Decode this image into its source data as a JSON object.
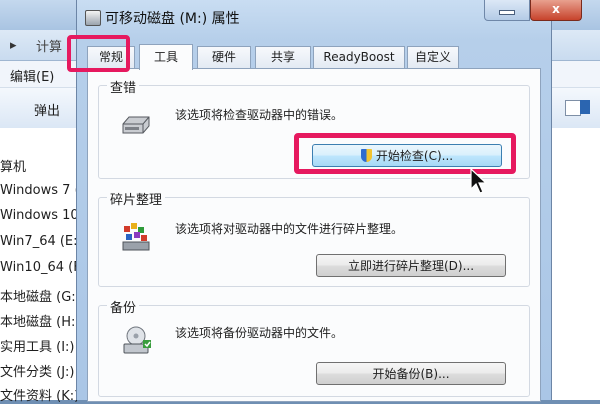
{
  "explorer": {
    "address_crumb": "计算",
    "menu": {
      "edit_label": "编辑(E)"
    },
    "toolbar": {
      "eject_label": "弹出"
    },
    "nav_items": [
      "算机",
      "Windows 7 (",
      "Windows 10",
      "Win7_64 (E:)",
      "Win10_64 (F:",
      "本地磁盘 (G:)",
      "本地磁盘 (H:)",
      "实用工具 (I:)",
      "文件分类 (J:)",
      "文件资料 (K:)"
    ]
  },
  "dialog": {
    "title": "可移动磁盘 (M:) 属性",
    "tabs": [
      "常规",
      "工具",
      "硬件",
      "共享",
      "ReadyBoost",
      "自定义"
    ],
    "active_tab": "工具",
    "sections": {
      "error_check": {
        "title": "查错",
        "description": "该选项将检查驱动器中的错误。",
        "button": "开始检查(C)..."
      },
      "defrag": {
        "title": "碎片整理",
        "description": "该选项将对驱动器中的文件进行碎片整理。",
        "button": "立即进行碎片整理(D)..."
      },
      "backup": {
        "title": "备份",
        "description": "该选项将备份驱动器中的文件。",
        "button": "开始备份(B)..."
      }
    }
  },
  "window_controls": {
    "close_glyph": "x"
  },
  "highlight_color": "#e6195f",
  "icons": [
    "drive-icon",
    "defrag-icon",
    "backup-icon",
    "shield-icon",
    "mouse-cursor-icon",
    "close-icon",
    "minimize-icon"
  ]
}
